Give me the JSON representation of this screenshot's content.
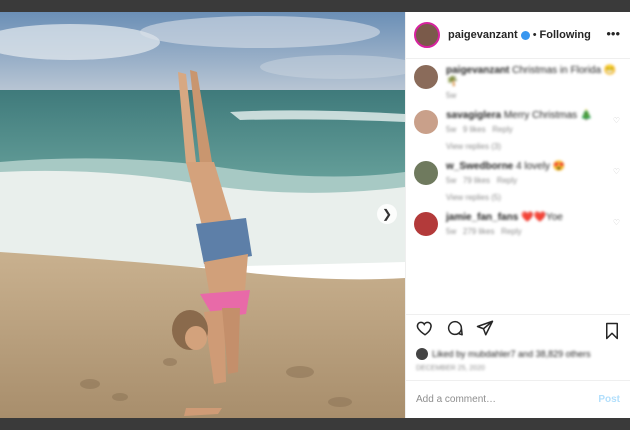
{
  "header": {
    "username": "paigevanzant",
    "separator": "•",
    "follow_state": "Following",
    "more_label": "•••"
  },
  "caption": {
    "username": "paigevanzant",
    "text": "Christmas in Florida 😁🌴",
    "time": "5w"
  },
  "comments": [
    {
      "username": "savagiglera",
      "text": "Merry Christmas 🎄",
      "time": "5w",
      "likes": "9 likes",
      "reply": "Reply",
      "view_replies": "View replies (3)"
    },
    {
      "username": "w_Swedborne",
      "text": "4 lovely 😍",
      "time": "5w",
      "likes": "79 likes",
      "reply": "Reply",
      "view_replies": "View replies (5)"
    },
    {
      "username": "jamie_fan_fans",
      "text": "❤️❤️Yoe",
      "time": "5w",
      "likes": "279 likes",
      "reply": "Reply",
      "view_replies": ""
    }
  ],
  "likes_text": "Liked by mubdahler7 and 38,829 others",
  "date_text": "DECEMBER 25, 2020",
  "add_comment": {
    "placeholder": "Add a comment…",
    "post_label": "Post"
  },
  "icons": {
    "next": "chevron-right-icon",
    "heart": "heart-icon",
    "comment": "comment-icon",
    "share": "share-icon",
    "save": "bookmark-icon"
  },
  "colors": {
    "accent": "#3897f0",
    "post_disabled": "#b2dffc",
    "story_ring": "#d6249f"
  }
}
